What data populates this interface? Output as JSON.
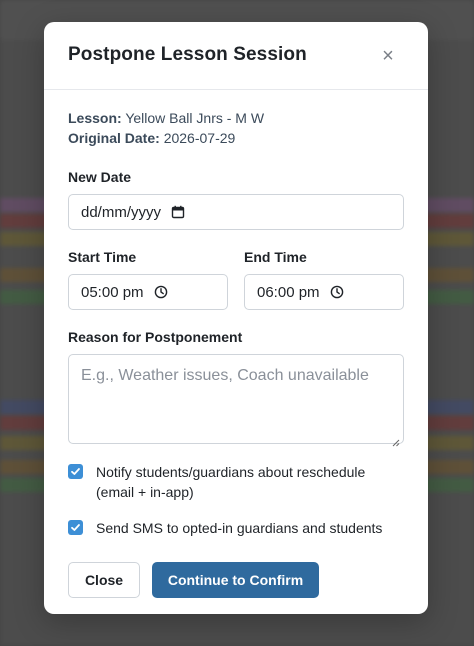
{
  "modal": {
    "title": "Postpone Lesson Session",
    "close_icon": "close-icon",
    "close_glyph": "×"
  },
  "lesson": {
    "lesson_key": "Lesson:",
    "lesson_value": "Yellow Ball Jnrs - M W",
    "date_key": "Original Date:",
    "date_value": "2026-07-29"
  },
  "new_date": {
    "label": "New Date",
    "value": "dd/mm/yyyy",
    "icon": "calendar-icon"
  },
  "start_time": {
    "label": "Start Time",
    "value": "05:00 pm",
    "icon": "clock-icon"
  },
  "end_time": {
    "label": "End Time",
    "value": "06:00 pm",
    "icon": "clock-icon"
  },
  "reason": {
    "label": "Reason for Postponement",
    "placeholder": "E.g., Weather issues, Coach unavailable",
    "value": ""
  },
  "options": [
    {
      "label": "Notify students/guardians about reschedule (email + in-app)",
      "checked": true
    },
    {
      "label": "Send SMS to opted-in guardians and students",
      "checked": true
    }
  ],
  "buttons": {
    "close_label": "Close",
    "confirm_label": "Continue to Confirm"
  },
  "colors": {
    "accent": "#2f6a9e",
    "checkbox": "#3d8fd6"
  }
}
